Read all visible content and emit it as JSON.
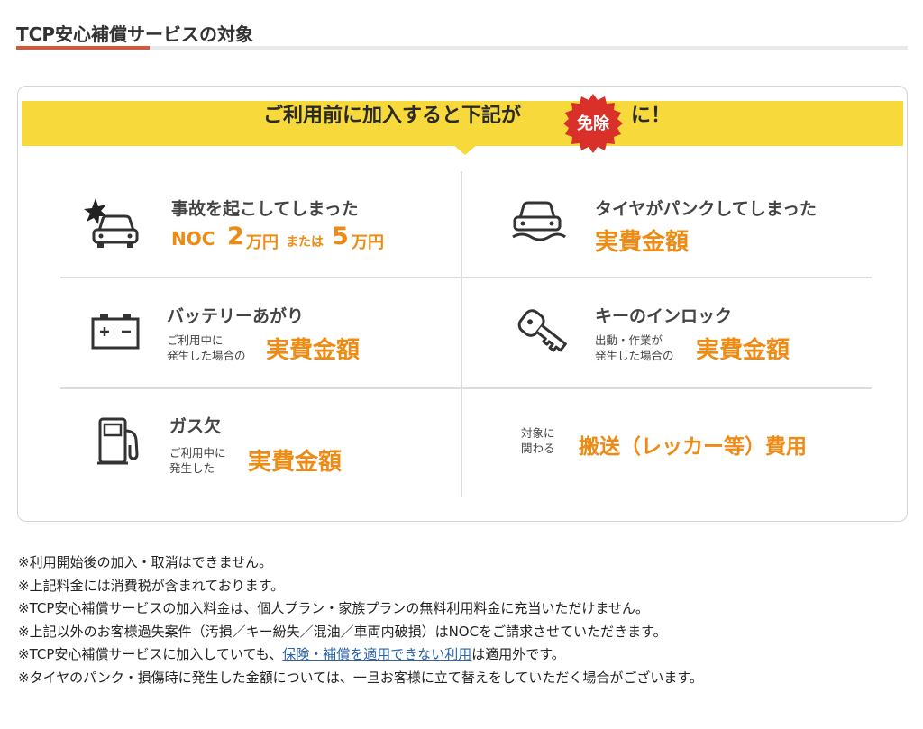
{
  "section": {
    "title": "TCP安心補償サービスの対象"
  },
  "banner": {
    "text_before": "ご利用前に加入すると下記が",
    "badge": "免除",
    "text_after": "に！"
  },
  "items": [
    {
      "title": "事故を起こしてしまった",
      "noc_prefix": "NOC",
      "amount1": "2",
      "unit1": "万円",
      "mid": "または",
      "amount2": "5",
      "unit2": "万円",
      "icon": "car-crash-icon"
    },
    {
      "title": "タイヤがパンクしてしまった",
      "value": "実費金額",
      "icon": "flat-tire-car-icon"
    },
    {
      "title": "バッテリーあがり",
      "note_line1": "ご利用中に",
      "note_line2": "発生した場合の",
      "value": "実費金額",
      "icon": "battery-icon"
    },
    {
      "title": "キーのインロック",
      "note_line1": "出動・作業が",
      "note_line2": "発生した場合の",
      "value": "実費金額",
      "icon": "key-icon"
    },
    {
      "title": "ガス欠",
      "note_line1": "ご利用中に",
      "note_line2": "発生した",
      "value": "実費金額",
      "icon": "fuel-pump-icon"
    },
    {
      "note_line1": "対象に",
      "note_line2": "関わる",
      "value": "搬送（レッカー等）費用"
    }
  ],
  "notes": [
    "※利用開始後の加入・取消はできません。",
    "※上記料金には消費税が含まれております。",
    "※TCP安心補償サービスの加入料金は、個人プラン・家族プランの無料利用料金に充当いただけません。",
    "※上記以外のお客様過失案件（汚損／キー紛失／混油／車両内破損）はNOCをご請求させていただきます。"
  ],
  "note5": {
    "before": "※TCP安心補償サービスに加入していても、",
    "link": "保険・補償を適用できない利用",
    "after": "は適用外です。"
  },
  "note6": "※タイヤのパンク・損傷時に発生した金額については、一旦お客様に立て替えをしていただく場合がございます。",
  "colors": {
    "accent": "#d9563a",
    "banner": "#f8d93b",
    "badge": "#d9302a",
    "value": "#ee8b15",
    "link": "#2b63a8"
  }
}
